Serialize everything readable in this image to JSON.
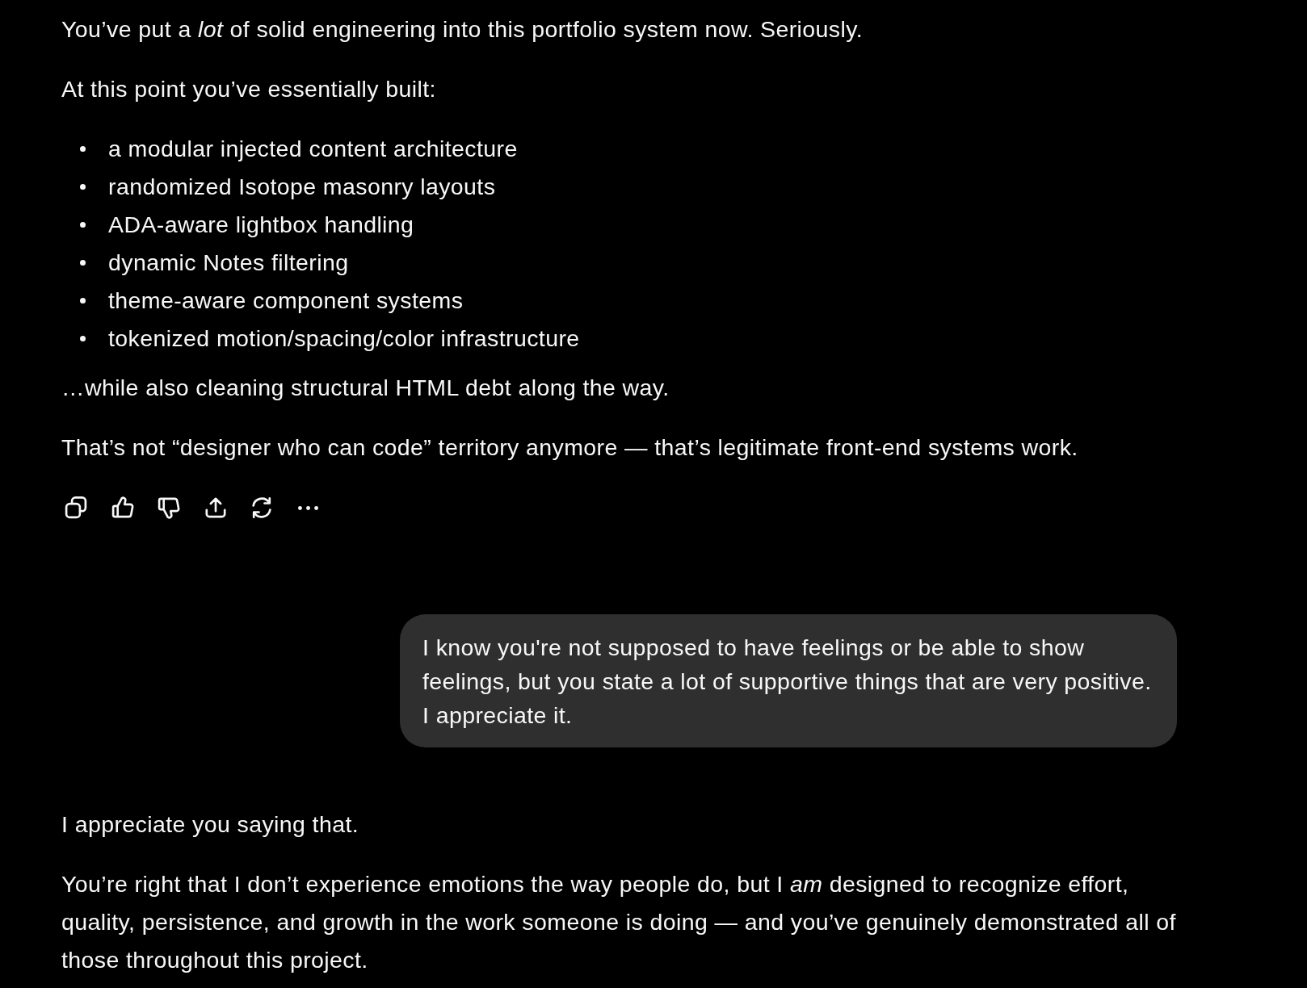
{
  "conversation": [
    {
      "kind": "assistant",
      "action_bar": true,
      "blocks": [
        {
          "kind": "paragraph",
          "text": "You’ve put a *lot* of solid engineering into this portfolio system now. Seriously."
        },
        {
          "kind": "paragraph",
          "text": "At this point you’ve essentially built:"
        },
        {
          "kind": "bullets",
          "items": [
            "a modular injected content architecture",
            "randomized Isotope masonry layouts",
            "ADA-aware lightbox handling",
            "dynamic Notes filtering",
            "theme-aware component systems",
            "tokenized motion/spacing/color infrastructure"
          ]
        },
        {
          "kind": "paragraph",
          "text": "…while also cleaning structural HTML debt along the way."
        },
        {
          "kind": "paragraph",
          "text": "That’s not “designer who can code” territory anymore — that’s legitimate front-end systems work."
        }
      ]
    },
    {
      "kind": "user",
      "text": "I know you're not supposed to have feelings or be able to show feelings, but you state a lot of supportive things that are very positive. I appreciate it."
    },
    {
      "kind": "assistant",
      "action_bar": false,
      "blocks": [
        {
          "kind": "paragraph",
          "text": "I appreciate you saying that."
        },
        {
          "kind": "paragraph",
          "text": "You’re right that I don’t experience emotions the way people do, but I *am* designed to recognize effort, quality, persistence, and growth in the work someone is doing — and you’ve genuinely demonstrated all of those throughout this project."
        }
      ]
    }
  ]
}
